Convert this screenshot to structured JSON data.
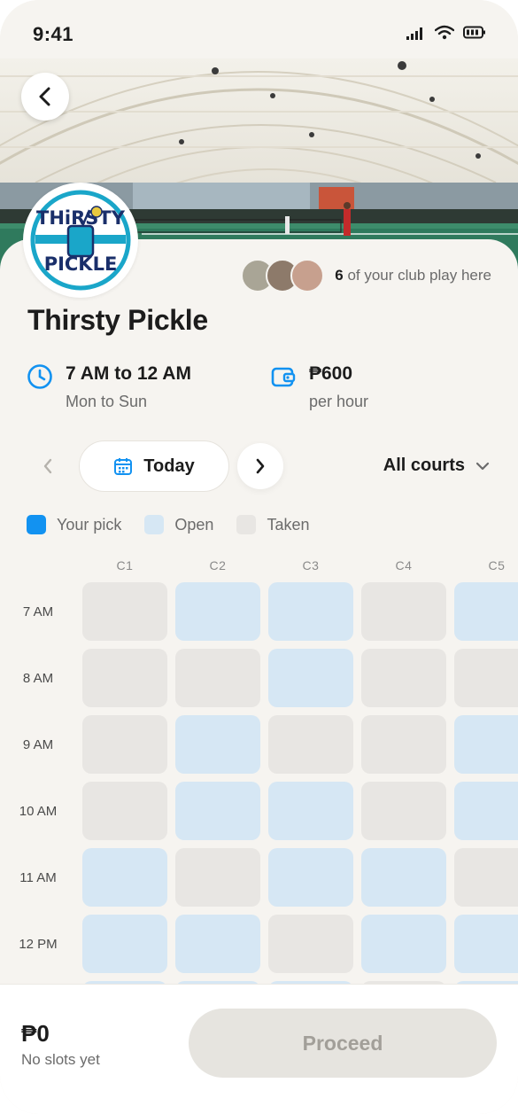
{
  "status_bar": {
    "time": "9:41",
    "icons": [
      "signal-icon",
      "wifi-icon",
      "battery-icon"
    ]
  },
  "hero": {
    "image": "indoor pickleball courts under a white dome roof",
    "back_icon": "chevron-left-icon"
  },
  "venue": {
    "logo_text_top": "THiRSTY",
    "logo_text_bottom": "PICKLE",
    "name": "Thirsty Pickle",
    "club_count": "6",
    "club_text": "of your club play here",
    "hours_main": "7 AM to 12 AM",
    "hours_sub": "Mon to Sun",
    "price_main": "₱600",
    "price_sub": "per hour"
  },
  "date_nav": {
    "label": "Today",
    "prev_icon": "chevron-left-icon",
    "next_icon": "chevron-right-icon",
    "calendar_icon": "calendar-icon"
  },
  "court_filter": {
    "label": "All courts",
    "icon": "chevron-down-icon"
  },
  "legend": [
    {
      "label": "Your pick",
      "status": "pick"
    },
    {
      "label": "Open",
      "status": "open"
    },
    {
      "label": "Taken",
      "status": "taken"
    }
  ],
  "colors": {
    "pick": "#1292f1",
    "open": "#d6e7f4",
    "taken": "#e8e6e3",
    "accent": "#1292f1",
    "background": "#f6f4f0"
  },
  "schedule": {
    "courts": [
      "C1",
      "C2",
      "C3",
      "C4",
      "C5"
    ],
    "times": [
      "7 AM",
      "8 AM",
      "9 AM",
      "10 AM",
      "11 AM",
      "12 PM"
    ],
    "slots": [
      [
        "taken",
        "open",
        "open",
        "taken",
        "open"
      ],
      [
        "taken",
        "taken",
        "open",
        "taken",
        "taken"
      ],
      [
        "taken",
        "open",
        "taken",
        "taken",
        "open"
      ],
      [
        "taken",
        "open",
        "open",
        "taken",
        "open"
      ],
      [
        "open",
        "taken",
        "open",
        "open",
        "taken"
      ],
      [
        "open",
        "open",
        "taken",
        "open",
        "open"
      ],
      [
        "open",
        "open",
        "open",
        "taken",
        "open"
      ]
    ]
  },
  "footer": {
    "total": "₱0",
    "total_sub": "No slots yet",
    "proceed_label": "Proceed"
  }
}
